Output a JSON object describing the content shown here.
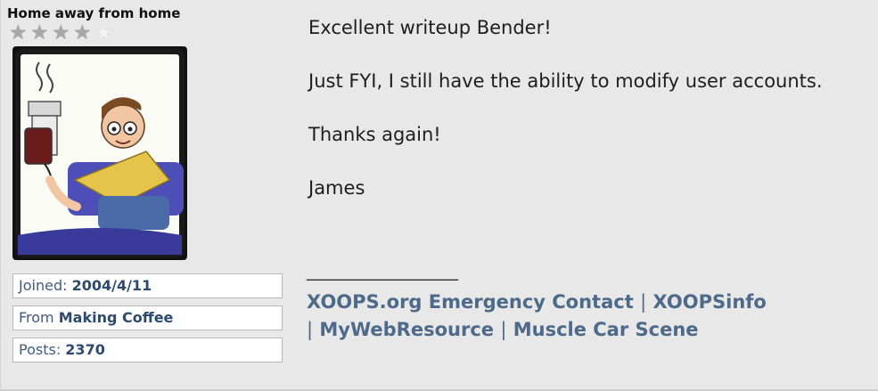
{
  "user": {
    "rank_title": "Home away from home",
    "rating": 4,
    "rating_max": 5,
    "avatar_icon": "coffee-machine-drip-avatar",
    "joined_label": "Joined:",
    "joined_value": "2004/4/11",
    "from_label": "From",
    "from_value": "Making Coffee",
    "posts_label": "Posts:",
    "posts_value": "2370"
  },
  "message": {
    "line1": "Excellent writeup Bender!",
    "line2": "Just FYI, I still have the ability to modify user accounts.",
    "line3": "Thanks again!",
    "line4": "James"
  },
  "signature": {
    "separator": "_________________",
    "links": [
      "XOOPS.org Emergency Contact",
      "XOOPSinfo",
      "MyWebResource",
      "Muscle Car Scene"
    ],
    "divider": "|"
  },
  "colors": {
    "background": "#e8e8e8",
    "link": "#4d6a8a",
    "info_value": "#2d4a6d"
  }
}
